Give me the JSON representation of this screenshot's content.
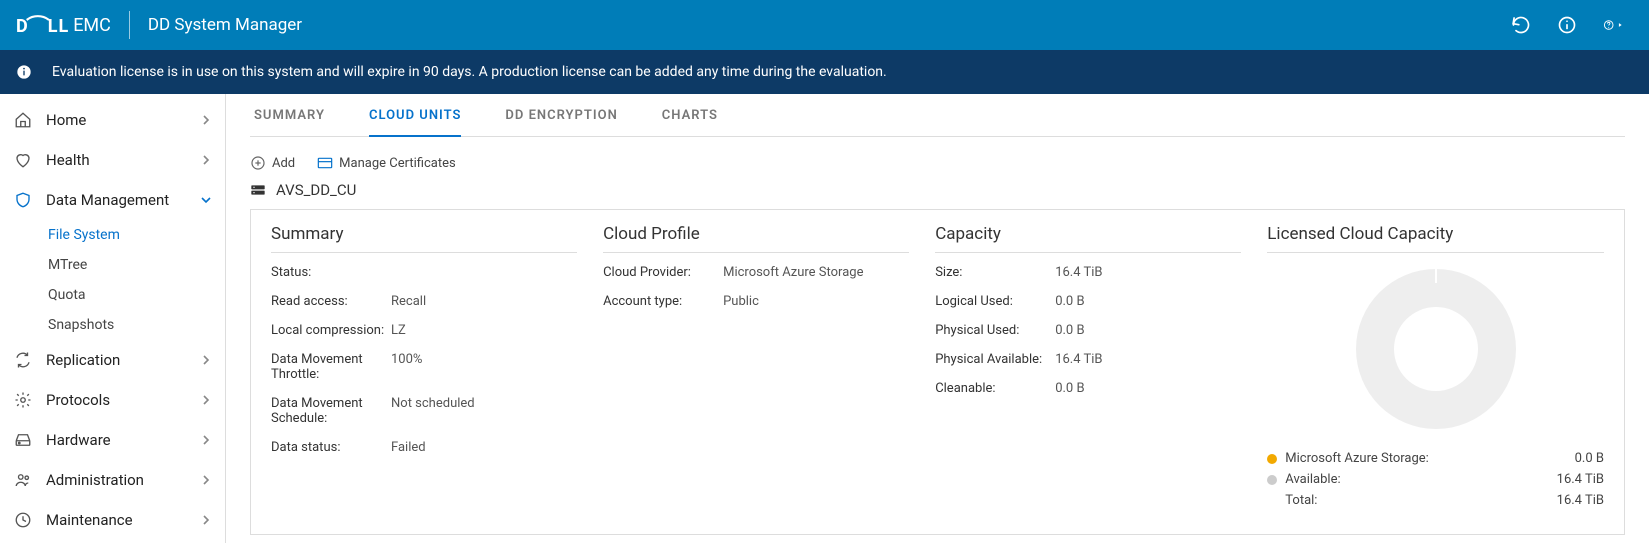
{
  "header": {
    "brand_logo": "D⌢LL",
    "brand_emc": "EMC",
    "title": "DD System Manager"
  },
  "notice": {
    "text": "Evaluation license is in use on this system and will expire in 90 days. A production license can be added any time during the evaluation."
  },
  "sidebar": {
    "items": [
      {
        "label": "Home"
      },
      {
        "label": "Health"
      },
      {
        "label": "Data Management"
      },
      {
        "label": "Replication"
      },
      {
        "label": "Protocols"
      },
      {
        "label": "Hardware"
      },
      {
        "label": "Administration"
      },
      {
        "label": "Maintenance"
      }
    ],
    "dm_sub": [
      {
        "label": "File System"
      },
      {
        "label": "MTree"
      },
      {
        "label": "Quota"
      },
      {
        "label": "Snapshots"
      }
    ]
  },
  "tabs": [
    {
      "label": "SUMMARY"
    },
    {
      "label": "CLOUD UNITS"
    },
    {
      "label": "DD ENCRYPTION"
    },
    {
      "label": "CHARTS"
    }
  ],
  "toolbar": {
    "add": "Add",
    "manage_certs": "Manage Certificates"
  },
  "unit": {
    "name": "AVS_DD_CU"
  },
  "summary": {
    "title": "Summary",
    "status_k": "Status:",
    "read_access_k": "Read access:",
    "read_access_v": "Recall",
    "local_compression_k": "Local compression:",
    "local_compression_v": "LZ",
    "dm_throttle_k": "Data Movement Throttle:",
    "dm_throttle_v": "100%",
    "dm_schedule_k": "Data Movement Schedule:",
    "dm_schedule_v": "Not scheduled",
    "data_status_k": "Data status:",
    "data_status_v": "Failed"
  },
  "cloud_profile": {
    "title": "Cloud Profile",
    "provider_k": "Cloud Provider:",
    "provider_v": "Microsoft Azure Storage",
    "account_type_k": "Account type:",
    "account_type_v": "Public"
  },
  "capacity": {
    "title": "Capacity",
    "size_k": "Size:",
    "size_v": "16.4 TiB",
    "logical_used_k": "Logical Used:",
    "logical_used_v": "0.0 B",
    "physical_used_k": "Physical Used:",
    "physical_used_v": "0.0 B",
    "physical_avail_k": "Physical Available:",
    "physical_avail_v": "16.4 TiB",
    "cleanable_k": "Cleanable:",
    "cleanable_v": "0.0 B"
  },
  "licensed": {
    "title": "Licensed Cloud Capacity",
    "legend": [
      {
        "label": "Microsoft Azure Storage:",
        "value": "0.0 B",
        "color": "orange"
      },
      {
        "label": "Available:",
        "value": "16.4 TiB",
        "color": "grey"
      },
      {
        "label": "Total:",
        "value": "16.4 TiB",
        "color": ""
      }
    ]
  },
  "chart_data": {
    "type": "pie",
    "title": "Licensed Cloud Capacity",
    "series": [
      {
        "name": "Microsoft Azure Storage",
        "value_label": "0.0 B",
        "value": 0,
        "units": "TiB"
      },
      {
        "name": "Available",
        "value_label": "16.4 TiB",
        "value": 16.4,
        "units": "TiB"
      }
    ],
    "total": {
      "label": "Total",
      "value_label": "16.4 TiB",
      "value": 16.4,
      "units": "TiB"
    }
  }
}
